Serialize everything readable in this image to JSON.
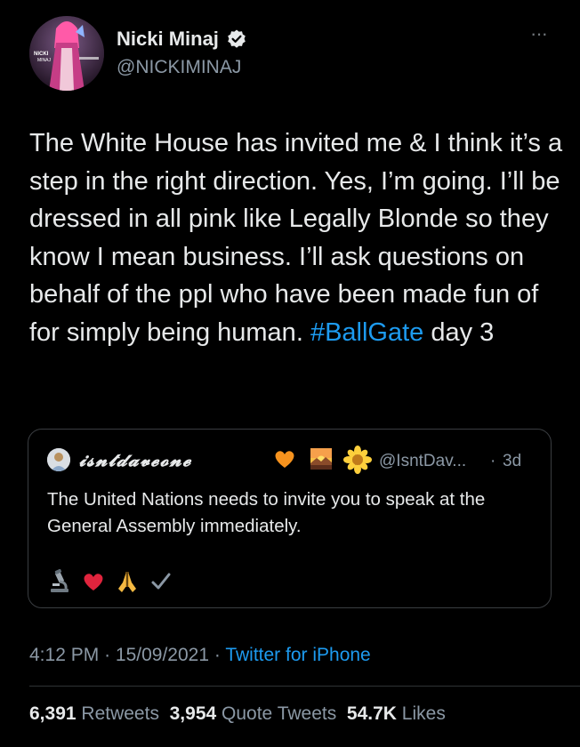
{
  "author": {
    "display_name": "Nicki Minaj",
    "handle": "@NICKIMINAJ",
    "verified": true,
    "avatar_text": "NICKI MINAJ"
  },
  "tweet": {
    "text_before": "The White House has invited me & I think it’s a step in the right direction. Yes, I’m going. I’ll be dressed in all pink like Legally Blonde so they know I mean business. I’ll ask questions on behalf of the ppl who have been made fun of for simply being human. ",
    "hashtag": "#BallGate",
    "text_after": " day 3",
    "time": "4:12 PM",
    "date": "15/09/2021",
    "separator": "·",
    "source": "Twitter for iPhone"
  },
  "quoted_tweet": {
    "display_name": "𝓲𝓼𝓷𝓽𝓭𝓪𝓿𝓮𝓸𝓷𝓮",
    "handle": "@IsntDav...",
    "separator": "·",
    "time": "3d",
    "text": "The United Nations needs to invite you to speak at the General Assembly immediately.",
    "name_emojis": [
      "orange-heart",
      "sunset",
      "sunflower"
    ],
    "emojis": [
      "microscope",
      "red-heart",
      "folded-hands",
      "check-mark"
    ]
  },
  "stats": {
    "retweets_count": "6,391",
    "retweets_label": "Retweets",
    "quotes_count": "3,954",
    "quotes_label": "Quote Tweets",
    "likes_count": "54.7K",
    "likes_label": "Likes"
  },
  "colors": {
    "background": "#000000",
    "text": "#e7e9ea",
    "secondary": "#8b98a5",
    "link": "#1d9bf0",
    "border": "#2f3336"
  }
}
